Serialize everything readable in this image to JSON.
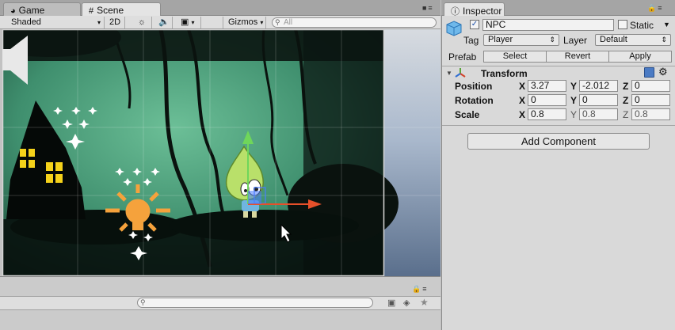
{
  "left_tabs": {
    "game": "Game",
    "scene": "Scene"
  },
  "right_tabs": {
    "inspector": "Inspector"
  },
  "scene_toolbar": {
    "shading": "Shaded",
    "mode2d": "2D",
    "gizmos": "Gizmos",
    "search_placeholder": "All"
  },
  "inspector": {
    "object_name": "NPC",
    "active_checked": true,
    "static_label": "Static",
    "tag_label": "Tag",
    "tag_value": "Player",
    "layer_label": "Layer",
    "layer_value": "Default",
    "prefab_label": "Prefab",
    "prefab_select": "Select",
    "prefab_revert": "Revert",
    "prefab_apply": "Apply",
    "transform_title": "Transform",
    "position_label": "Position",
    "rotation_label": "Rotation",
    "scale_label": "Scale",
    "axis": {
      "x": "X",
      "y": "Y",
      "z": "Z"
    },
    "position": {
      "x": "3.27",
      "y": "-2.012",
      "z": "0"
    },
    "rotation": {
      "x": "0",
      "y": "0",
      "z": "0"
    },
    "scale": {
      "x": "0.8",
      "y": "0.8",
      "z": "0.8"
    },
    "add_component": "Add Component"
  },
  "colors": {
    "scene_teal": "#3f8f6e",
    "window_yellow": "#f5d21a",
    "lightbulb_orange": "#f5a23c",
    "gizmo_green": "#6fd65a",
    "gizmo_red": "#e6502a",
    "sky_blue": "#a9b8cc"
  }
}
